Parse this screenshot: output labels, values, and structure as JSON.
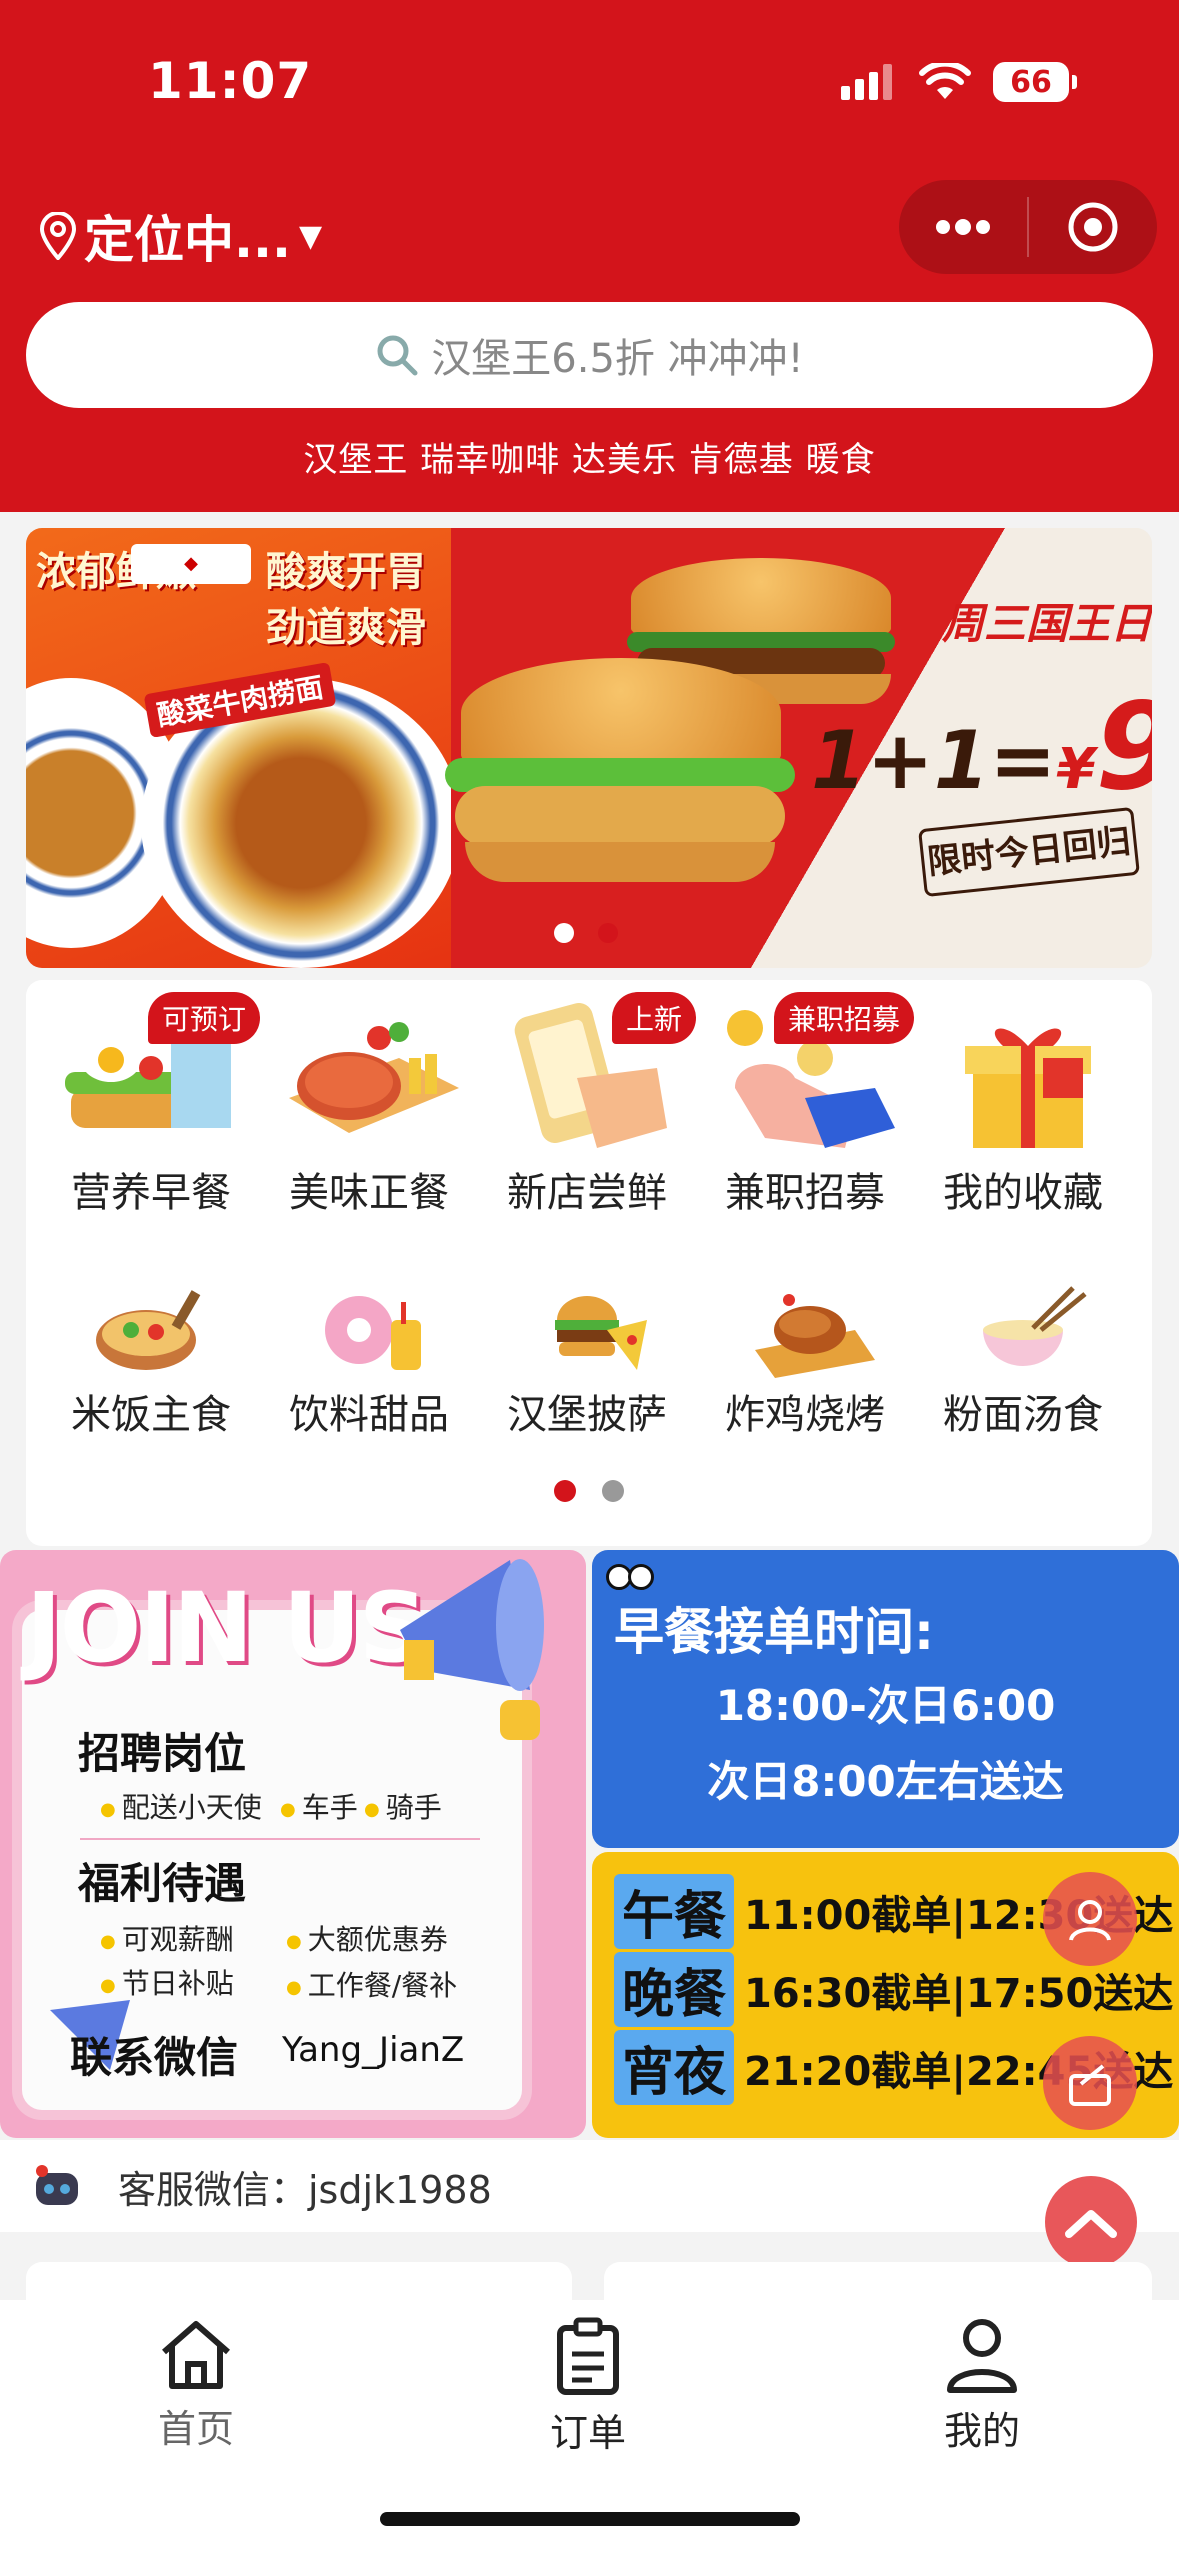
{
  "status_bar": {
    "time": "11:07",
    "battery": "66"
  },
  "header": {
    "location": "定位中...",
    "search_placeholder": "汉堡王6.5折 冲冲冲!",
    "hot_words": "汉堡王 瑞幸咖啡 达美乐 肯德基 暖食",
    "accent_color": "#d3141b"
  },
  "banner": {
    "left": {
      "text1": "浓郁鲜嫩",
      "text2": "酸爽开胃劲道爽滑",
      "label": "酸菜牛肉捞面"
    },
    "right": {
      "title": "周三国王日",
      "price_prefix": "1+1=",
      "price_symbol": "¥",
      "price": "9",
      "tag": "限时今日回归"
    },
    "dots": 2,
    "active_dot": 1
  },
  "categories": [
    {
      "label": "营养早餐",
      "badge": "可预订",
      "icon": "breakfast-icon"
    },
    {
      "label": "美味正餐",
      "badge": "",
      "icon": "steak-icon"
    },
    {
      "label": "新店尝鲜",
      "badge": "上新",
      "icon": "phone-hand-icon"
    },
    {
      "label": "兼职招募",
      "badge": "兼职招募",
      "icon": "coin-hand-icon"
    },
    {
      "label": "我的收藏",
      "badge": "",
      "icon": "gift-box-icon"
    },
    {
      "label": "米饭主食",
      "badge": "",
      "icon": "rice-bowl-icon"
    },
    {
      "label": "饮料甜品",
      "badge": "",
      "icon": "donut-drink-icon"
    },
    {
      "label": "汉堡披萨",
      "badge": "",
      "icon": "burger-pizza-icon"
    },
    {
      "label": "炸鸡烧烤",
      "badge": "",
      "icon": "roast-chicken-icon"
    },
    {
      "label": "粉面汤食",
      "badge": "",
      "icon": "noodle-icon"
    }
  ],
  "promo_join": {
    "title": "JOIN US",
    "positions_title": "招聘岗位",
    "positions": [
      "配送小天使",
      "车手",
      "骑手"
    ],
    "benefits_title": "福利待遇",
    "benefits": [
      "可观薪酬",
      "大额优惠券",
      "节日补贴",
      "工作餐/餐补"
    ],
    "contact_label": "联系微信",
    "contact_id": "Yang_JianZ"
  },
  "promo_breakfast": {
    "title": "早餐接单时间:",
    "line1": "18:00-次日6:00",
    "line2": "次日8:00左右送达"
  },
  "promo_schedule": [
    {
      "tag": "午餐",
      "text": "11:00截单|12:30送达"
    },
    {
      "tag": "晚餐",
      "text": "16:30截单|17:50送达"
    },
    {
      "tag": "宵夜",
      "text": "21:20截单|22:45送达"
    }
  ],
  "service": {
    "text": "客服微信：jsdjk1988"
  },
  "tabbar": [
    {
      "label": "首页",
      "icon": "home-icon"
    },
    {
      "label": "订单",
      "icon": "clipboard-icon"
    },
    {
      "label": "我的",
      "icon": "user-icon"
    }
  ]
}
